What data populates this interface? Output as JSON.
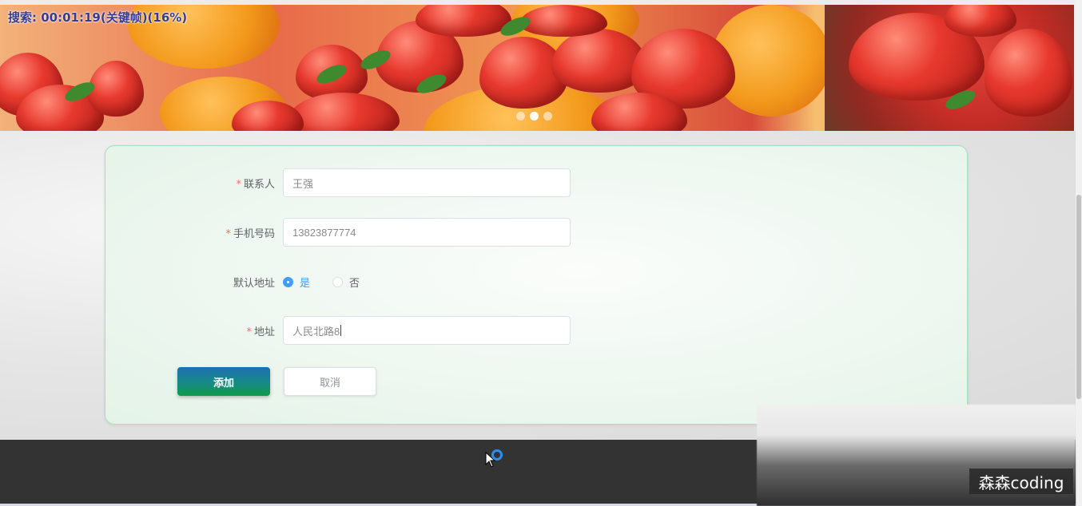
{
  "banner": {
    "overlay_text": "搜索: 00:01:19(关键帧)(16%)",
    "slides_count": 3,
    "active_slide": 2
  },
  "form": {
    "contact": {
      "label": "联系人",
      "required": true,
      "value": "王强"
    },
    "phone": {
      "label": "手机号码",
      "required": true,
      "value": "13823877774"
    },
    "default_address": {
      "label": "默认地址",
      "options": [
        {
          "label": "是",
          "checked": true
        },
        {
          "label": "否",
          "checked": false
        }
      ]
    },
    "address": {
      "label": "地址",
      "required": true,
      "value": "人民北路8"
    },
    "submit_label": "添加",
    "cancel_label": "取消"
  },
  "watermark": {
    "text": "森森coding"
  },
  "colors": {
    "card_border": "#a9dcc0",
    "accent_blue": "#409eff",
    "required_red": "#f56c6c",
    "footer": "#333333"
  }
}
